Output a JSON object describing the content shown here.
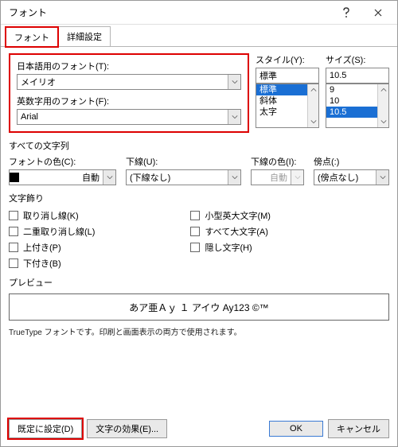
{
  "title": "フォント",
  "tabs": {
    "font": "フォント",
    "advanced": "詳細設定"
  },
  "font": {
    "jp_label": "日本語用のフォント(T):",
    "jp_value": "メイリオ",
    "ascii_label": "英数字用のフォント(F):",
    "ascii_value": "Arial"
  },
  "style": {
    "label": "スタイル(Y):",
    "value": "標準",
    "options": [
      "標準",
      "斜体",
      "太字"
    ]
  },
  "size": {
    "label": "サイズ(S):",
    "value": "10.5",
    "options": [
      "9",
      "10",
      "10.5"
    ]
  },
  "allchars": {
    "section": "すべての文字列",
    "fontcolor_label": "フォントの色(C):",
    "fontcolor_value": "自動",
    "underline_label": "下線(U):",
    "underline_value": "(下線なし)",
    "ulcolor_label": "下線の色(I):",
    "ulcolor_value": "自動",
    "emph_label": "傍点(:)",
    "emph_value": "(傍点なし)"
  },
  "decor": {
    "section": "文字飾り",
    "strike": "取り消し線(K)",
    "dblstrike": "二重取り消し線(L)",
    "sup": "上付き(P)",
    "sub": "下付き(B)",
    "smallcaps": "小型英大文字(M)",
    "allcaps": "すべて大文字(A)",
    "hidden": "隠し文字(H)"
  },
  "preview": {
    "section": "プレビュー",
    "text": "あア亜Ａｙ １ アイウ Ay123 ©™"
  },
  "note": "TrueType フォントです。印刷と画面表示の両方で使用されます。",
  "buttons": {
    "setdefault": "既定に設定(D)",
    "texteffects": "文字の効果(E)...",
    "ok": "OK",
    "cancel": "キャンセル"
  }
}
